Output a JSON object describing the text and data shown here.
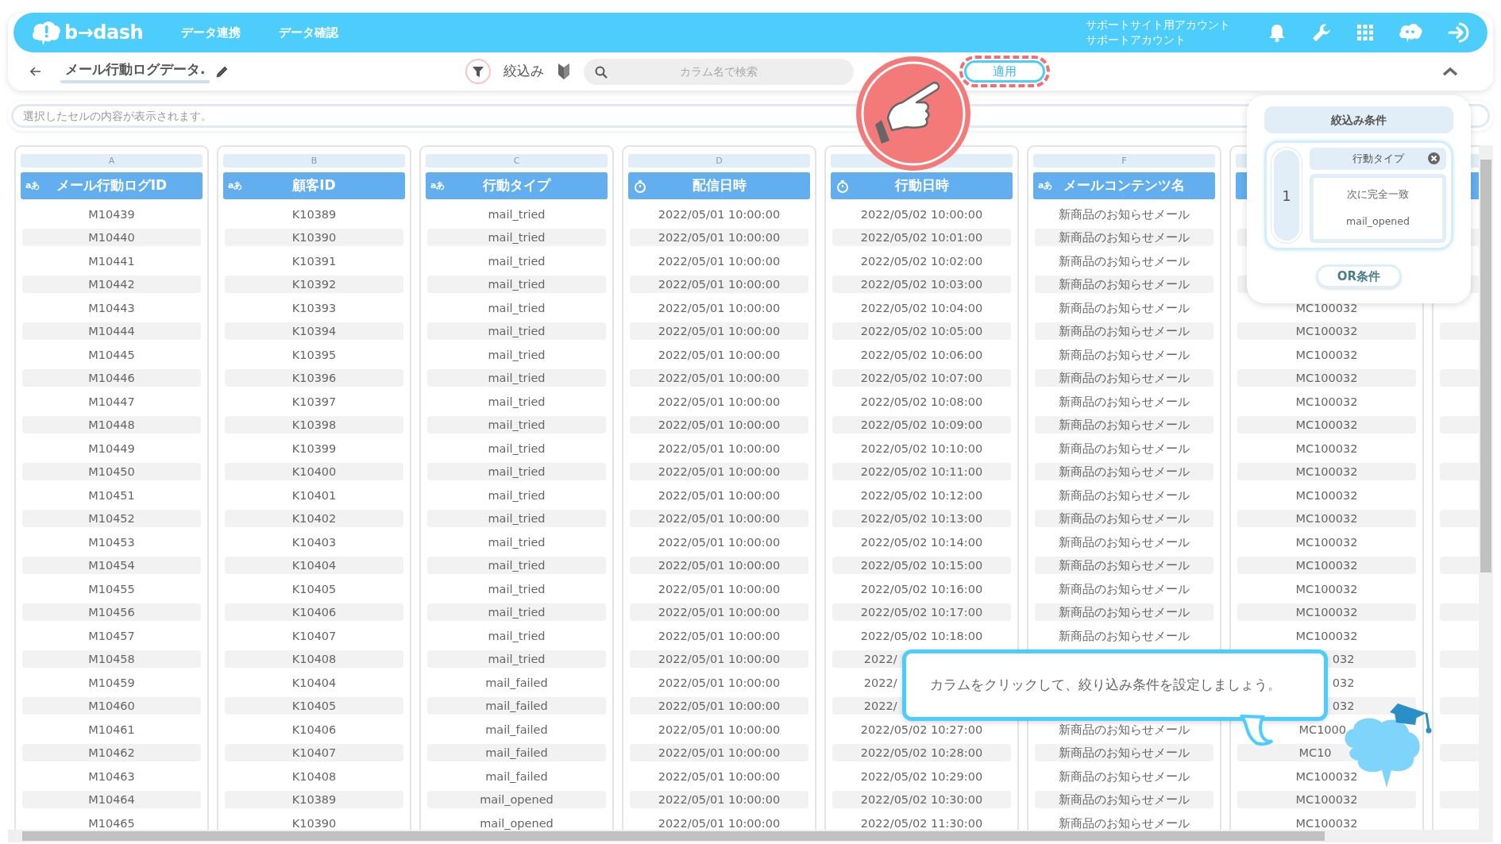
{
  "navbar": {
    "logo": "b→dash",
    "links": [
      "データ連携",
      "データ確認"
    ],
    "account": [
      "サポートサイト用アカウント",
      "サポートアカウント"
    ]
  },
  "toolbar": {
    "title": "メール行動ログデータ.",
    "filter_label": "絞込み",
    "search": {
      "placeholder": "カラム名で検索"
    },
    "apply_button": "適用"
  },
  "cell_viewer": {
    "placeholder": "選択したセルの内容が表示されます。"
  },
  "table": {
    "columns": [
      {
        "letter": "A",
        "name": "メール行動ログID",
        "kind": "text",
        "type_label": "aあ"
      },
      {
        "letter": "B",
        "name": "顧客ID",
        "kind": "text",
        "type_label": "aあ"
      },
      {
        "letter": "C",
        "name": "行動タイプ",
        "kind": "text",
        "type_label": "aあ"
      },
      {
        "letter": "D",
        "name": "配信日時",
        "kind": "datetime"
      },
      {
        "name": "行動日時",
        "kind": "datetime"
      },
      {
        "letter": "F",
        "name": "メールコンテンツ名",
        "kind": "text",
        "type_label": "aあ"
      },
      {
        "kind": "covered"
      }
    ],
    "rows": [
      [
        "M10439",
        "K10389",
        "mail_tried",
        "2022/05/01 10:00:00",
        "2022/05/02 10:00:00",
        "新商品のお知らせメール",
        null
      ],
      [
        "M10440",
        "K10390",
        "mail_tried",
        "2022/05/01 10:00:00",
        "2022/05/02 10:01:00",
        "新商品のお知らせメール",
        null
      ],
      [
        "M10441",
        "K10391",
        "mail_tried",
        "2022/05/01 10:00:00",
        "2022/05/02 10:02:00",
        "新商品のお知らせメール",
        null
      ],
      [
        "M10442",
        "K10392",
        "mail_tried",
        "2022/05/01 10:00:00",
        "2022/05/02 10:03:00",
        "新商品のお知らせメール",
        null
      ],
      [
        "M10443",
        "K10393",
        "mail_tried",
        "2022/05/01 10:00:00",
        "2022/05/02 10:04:00",
        "新商品のお知らせメール",
        "MC100032"
      ],
      [
        "M10444",
        "K10394",
        "mail_tried",
        "2022/05/01 10:00:00",
        "2022/05/02 10:05:00",
        "新商品のお知らせメール",
        "MC100032"
      ],
      [
        "M10445",
        "K10395",
        "mail_tried",
        "2022/05/01 10:00:00",
        "2022/05/02 10:06:00",
        "新商品のお知らせメール",
        "MC100032"
      ],
      [
        "M10446",
        "K10396",
        "mail_tried",
        "2022/05/01 10:00:00",
        "2022/05/02 10:07:00",
        "新商品のお知らせメール",
        "MC100032"
      ],
      [
        "M10447",
        "K10397",
        "mail_tried",
        "2022/05/01 10:00:00",
        "2022/05/02 10:08:00",
        "新商品のお知らせメール",
        "MC100032"
      ],
      [
        "M10448",
        "K10398",
        "mail_tried",
        "2022/05/01 10:00:00",
        "2022/05/02 10:09:00",
        "新商品のお知らせメール",
        "MC100032"
      ],
      [
        "M10449",
        "K10399",
        "mail_tried",
        "2022/05/01 10:00:00",
        "2022/05/02 10:10:00",
        "新商品のお知らせメール",
        "MC100032"
      ],
      [
        "M10450",
        "K10400",
        "mail_tried",
        "2022/05/01 10:00:00",
        "2022/05/02 10:11:00",
        "新商品のお知らせメール",
        "MC100032"
      ],
      [
        "M10451",
        "K10401",
        "mail_tried",
        "2022/05/01 10:00:00",
        "2022/05/02 10:12:00",
        "新商品のお知らせメール",
        "MC100032"
      ],
      [
        "M10452",
        "K10402",
        "mail_tried",
        "2022/05/01 10:00:00",
        "2022/05/02 10:13:00",
        "新商品のお知らせメール",
        "MC100032"
      ],
      [
        "M10453",
        "K10403",
        "mail_tried",
        "2022/05/01 10:00:00",
        "2022/05/02 10:14:00",
        "新商品のお知らせメール",
        "MC100032"
      ],
      [
        "M10454",
        "K10404",
        "mail_tried",
        "2022/05/01 10:00:00",
        "2022/05/02 10:15:00",
        "新商品のお知らせメール",
        "MC100032"
      ],
      [
        "M10455",
        "K10405",
        "mail_tried",
        "2022/05/01 10:00:00",
        "2022/05/02 10:16:00",
        "新商品のお知らせメール",
        "MC100032"
      ],
      [
        "M10456",
        "K10406",
        "mail_tried",
        "2022/05/01 10:00:00",
        "2022/05/02 10:17:00",
        "新商品のお知らせメール",
        "MC100032"
      ],
      [
        "M10457",
        "K10407",
        "mail_tried",
        "2022/05/01 10:00:00",
        "2022/05/02 10:18:00",
        "新商品のお知らせメール",
        "MC100032"
      ],
      [
        "M10458",
        "K10408",
        "mail_tried",
        "2022/05/01 10:00:00",
        {
          "text": "2022/",
          "clipped_end": true
        },
        null,
        {
          "text": "032",
          "clipped_start": true
        }
      ],
      [
        "M10459",
        "K10404",
        "mail_failed",
        "2022/05/01 10:00:00",
        {
          "text": "2022/",
          "clipped_end": true
        },
        null,
        {
          "text": "032",
          "clipped_start": true
        }
      ],
      [
        "M10460",
        "K10405",
        "mail_failed",
        "2022/05/01 10:00:00",
        {
          "text": "2022/",
          "clipped_end": true
        },
        null,
        {
          "text": "032",
          "clipped_start": true
        }
      ],
      [
        "M10461",
        "K10406",
        "mail_failed",
        "2022/05/01 10:00:00",
        "2022/05/02 10:27:00",
        "新商品のお知らせメール",
        {
          "text": "MC1000",
          "clipped_end": true
        }
      ],
      [
        "M10462",
        "K10407",
        "mail_failed",
        "2022/05/01 10:00:00",
        "2022/05/02 10:28:00",
        "新商品のお知らせメール",
        {
          "text": "MC10",
          "clipped_end": true
        }
      ],
      [
        "M10463",
        "K10408",
        "mail_failed",
        "2022/05/01 10:00:00",
        "2022/05/02 10:29:00",
        "新商品のお知らせメール",
        "MC100032"
      ],
      [
        "M10464",
        "K10389",
        "mail_opened",
        "2022/05/01 10:00:00",
        "2022/05/02 10:30:00",
        "新商品のお知らせメール",
        "MC100032"
      ],
      [
        "M10465",
        "K10390",
        "mail_opened",
        "2022/05/01 10:00:00",
        "2022/05/02 11:30:00",
        "新商品のお知らせメール",
        "MC100032"
      ]
    ]
  },
  "filter_panel": {
    "title": "絞込み条件",
    "conditions": [
      {
        "number": "1",
        "column": "行動タイプ",
        "operator": "次に完全一致",
        "value": "mail_opened"
      }
    ],
    "or_button": "OR条件"
  },
  "hint": {
    "text": "カラムをクリックして、絞り込み条件を設定しましょう。"
  }
}
